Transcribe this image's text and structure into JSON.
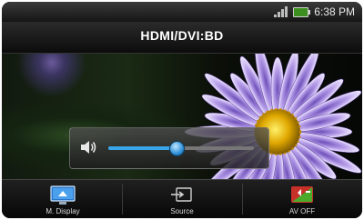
{
  "status": {
    "time": "6:38 PM",
    "signal_icon": "signal-icon",
    "battery_icon": "battery-icon"
  },
  "title": "HDMI/DVI:BD",
  "volume": {
    "icon": "speaker-icon",
    "level": 0.47
  },
  "bottombar": {
    "m_display": {
      "label": "M. Display",
      "icon": "monitor-icon"
    },
    "source": {
      "label": "Source",
      "icon": "input-source-icon"
    },
    "av_off": {
      "label": "AV OFF",
      "icon": "av-off-icon"
    }
  },
  "colors": {
    "accent": "#38a6e8",
    "flower_petal": "#a98fe0",
    "flower_center": "#e8b400"
  }
}
